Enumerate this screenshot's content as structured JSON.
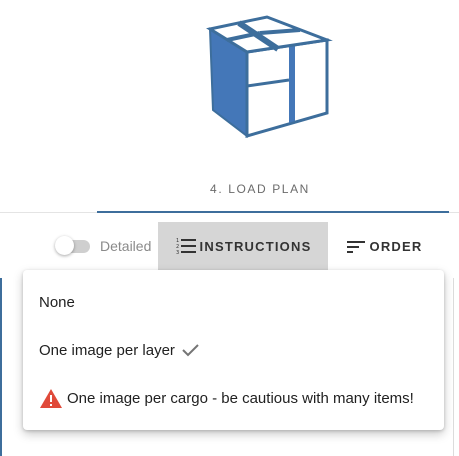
{
  "stepper": {
    "tab_label": "4. LOAD PLAN",
    "cube_icon": "load-plan-cube-icon",
    "accent_color": "#3d6e9c"
  },
  "toolbar": {
    "detailed_label": "Detailed",
    "detailed_on": false,
    "instructions_label": "INSTRUCTIONS",
    "instructions_icon": "numbered-list-icon",
    "order_label": "ORDER",
    "order_icon": "sort-icon"
  },
  "menu": {
    "items": [
      {
        "label": "None",
        "selected": false
      },
      {
        "label": "One image per layer",
        "selected": true,
        "icon": "check-icon"
      },
      {
        "label": "One image per cargo - be cautious with many items!",
        "selected": false,
        "icon": "warning-icon",
        "icon_color": "#e04a3a"
      }
    ]
  }
}
